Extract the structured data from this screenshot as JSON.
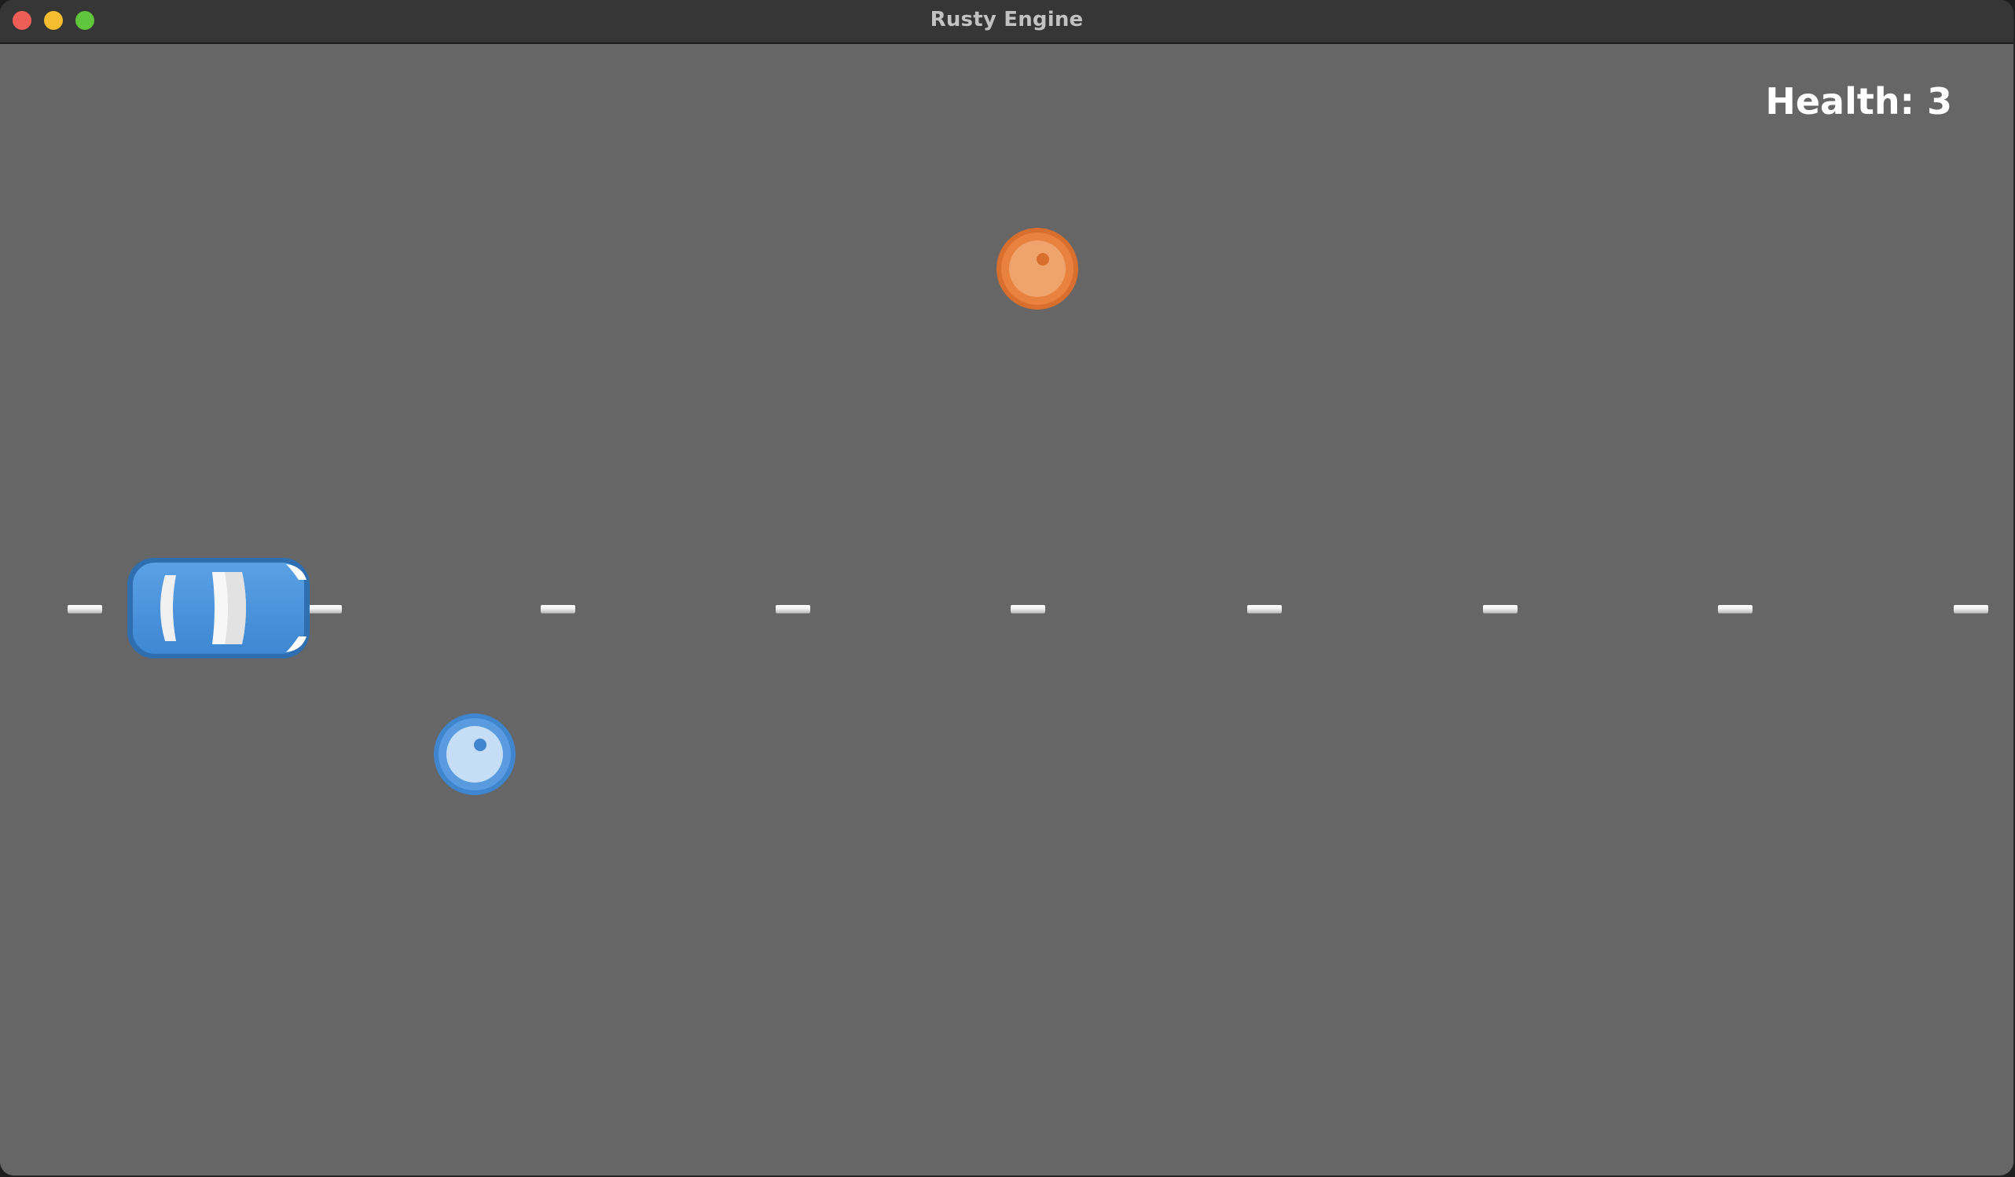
{
  "window": {
    "title": "Rusty Engine"
  },
  "hud": {
    "health_text": "Health: 3"
  },
  "sprites": {
    "player_car": {
      "name": "blue-car",
      "color": "#4a90d9"
    },
    "orange_marble": {
      "name": "orange-barrel",
      "color": "#e07b39"
    },
    "blue_marble": {
      "name": "blue-barrel",
      "color": "#4a90d9"
    }
  },
  "colors": {
    "road": "#666666",
    "lane_line": "#f2f2f2",
    "titlebar": "#363636"
  }
}
